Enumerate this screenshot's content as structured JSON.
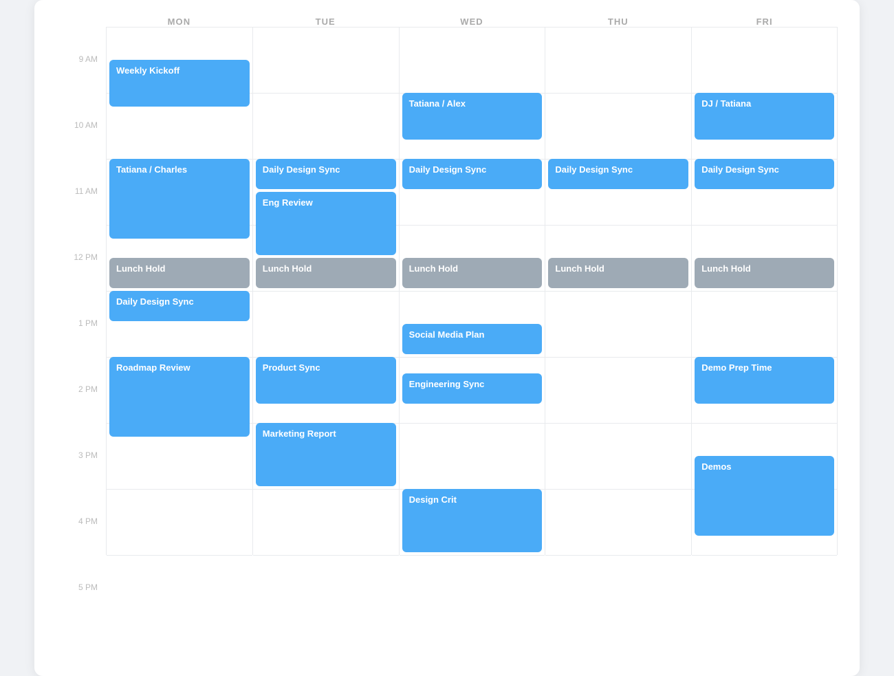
{
  "calendar": {
    "days": [
      "MON",
      "TUE",
      "WED",
      "THU",
      "FRI"
    ],
    "times": [
      "9 AM",
      "10 AM",
      "11 AM",
      "12 PM",
      "1 PM",
      "2 PM",
      "3 PM",
      "4 PM",
      "5 PM"
    ],
    "hourHeight": 96,
    "startHour": 9,
    "events": {
      "mon": [
        {
          "label": "Weekly Kickoff",
          "color": "blue",
          "startHour": 9.5,
          "endHour": 10.25
        },
        {
          "label": "Tatiana / Charles",
          "color": "blue",
          "startHour": 11.0,
          "endHour": 12.25
        },
        {
          "label": "Lunch Hold",
          "color": "gray",
          "startHour": 12.5,
          "endHour": 13.0
        },
        {
          "label": "Daily Design Sync",
          "color": "blue",
          "startHour": 13.0,
          "endHour": 13.5
        },
        {
          "label": "Roadmap Review",
          "color": "blue",
          "startHour": 14.0,
          "endHour": 15.25
        }
      ],
      "tue": [
        {
          "label": "Daily Design Sync",
          "color": "blue",
          "startHour": 11.0,
          "endHour": 11.5
        },
        {
          "label": "Eng Review",
          "color": "blue",
          "startHour": 11.5,
          "endHour": 12.5
        },
        {
          "label": "Lunch Hold",
          "color": "gray",
          "startHour": 12.5,
          "endHour": 13.0
        },
        {
          "label": "Product Sync",
          "color": "blue",
          "startHour": 14.0,
          "endHour": 14.75
        },
        {
          "label": "Marketing Report",
          "color": "blue",
          "startHour": 15.0,
          "endHour": 16.0
        }
      ],
      "wed": [
        {
          "label": "Tatiana / Alex",
          "color": "blue",
          "startHour": 10.0,
          "endHour": 10.75
        },
        {
          "label": "Daily Design Sync",
          "color": "blue",
          "startHour": 11.0,
          "endHour": 11.5
        },
        {
          "label": "Lunch Hold",
          "color": "gray",
          "startHour": 12.5,
          "endHour": 13.0
        },
        {
          "label": "Social Media Plan",
          "color": "blue",
          "startHour": 13.5,
          "endHour": 14.0
        },
        {
          "label": "Engineering Sync",
          "color": "blue",
          "startHour": 14.25,
          "endHour": 14.75
        },
        {
          "label": "Design Crit",
          "color": "blue",
          "startHour": 16.0,
          "endHour": 17.0
        }
      ],
      "thu": [
        {
          "label": "Daily Design Sync",
          "color": "blue",
          "startHour": 11.0,
          "endHour": 11.5
        },
        {
          "label": "Lunch Hold",
          "color": "gray",
          "startHour": 12.5,
          "endHour": 13.0
        }
      ],
      "fri": [
        {
          "label": "DJ / Tatiana",
          "color": "blue",
          "startHour": 10.0,
          "endHour": 10.75
        },
        {
          "label": "Daily Design Sync",
          "color": "blue",
          "startHour": 11.0,
          "endHour": 11.5
        },
        {
          "label": "Lunch Hold",
          "color": "gray",
          "startHour": 12.5,
          "endHour": 13.0
        },
        {
          "label": "Demo Prep Time",
          "color": "blue",
          "startHour": 14.0,
          "endHour": 14.75
        },
        {
          "label": "Demos",
          "color": "blue",
          "startHour": 15.5,
          "endHour": 16.75
        }
      ]
    }
  }
}
